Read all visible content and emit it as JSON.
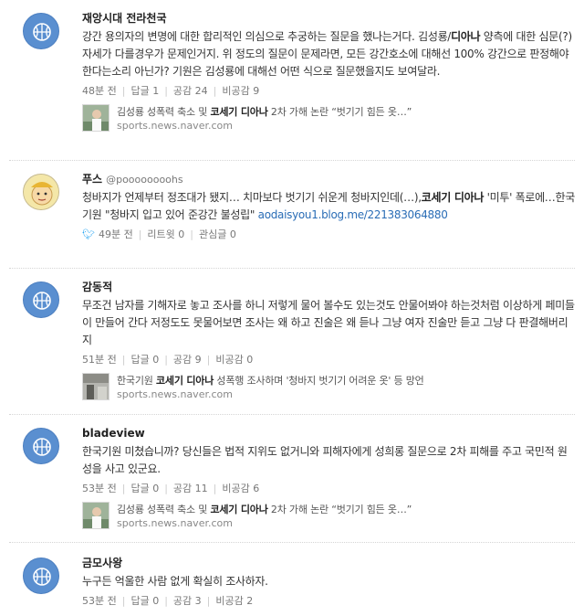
{
  "comments": [
    {
      "author": "재앙시대 전라천국",
      "text_a": "강간 용의자의 변명에 대한 합리적인 의심으로 추궁하는 질문을 했나는거다. 김성룡/",
      "text_bold": "디아나",
      "text_b": " 양측에 대한 심문(?)자세가 다를경우가 문제인거지. 위 정도의 질문이 문제라면, 모든 강간호소에 대해선 100% 강간으로 판정해야 한다는소리 아닌가? 기원은 김성룡에 대해선 어떤 식으로 질문했을지도 보여달라.",
      "time": "48분 전",
      "reply": "답글 1",
      "like": "공감 24",
      "dislike": "비공감 9",
      "news_a": "김성룡 성폭력 축소 및 ",
      "news_bold": "코세기 디아나",
      "news_b": " 2차 가해 논란 “벗기기 힘든 옷…”",
      "news_src": "sports.news.naver.com"
    },
    {
      "author": "푸스",
      "handle": "@poooooooohs",
      "text_a": "청바지가 언제부터 정조대가 됐지… 치마보다 벗기기 쉬운게 청바지인데(…),",
      "text_bold": "코세기 디아나",
      "text_b": " '미투' 폭로에…한국기원 \"청바지 입고 있어 준강간 불성립\" ",
      "text_link": "aodaisyou1.blog.me/221383064880",
      "time": "49분 전",
      "retweet": "리트윗 0",
      "interest": "관심글 0"
    },
    {
      "author": "감동적",
      "text": "무조건 남자를 기해자로 놓고 조사를 하니 저렇게 물어 볼수도 있는것도 안물어봐야 하는것처럼 이상하게 페미들이 만들어 간다 저정도도 못물어보면 조사는 왜 하고 진술은 왜 듣나 그냥 여자 진술만 듣고 그냥 다 판결해버리지",
      "time": "51분 전",
      "reply": "답글 0",
      "like": "공감 9",
      "dislike": "비공감 0",
      "news_a": "한국기원 ",
      "news_bold": "코세기 디아나",
      "news_b": " 성폭행 조사하며 '청바지 벗기기 어려운 옷' 등 망언",
      "news_src": "sports.news.naver.com"
    },
    {
      "author": "bladeview",
      "text": "한국기원 미쳤습니까? 당신들은 법적 지위도 없거니와 피해자에게 성희롱 질문으로 2차 피해를 주고 국민적 원성을 사고 있군요.",
      "time": "53분 전",
      "reply": "답글 0",
      "like": "공감 11",
      "dislike": "비공감 6",
      "news_a": "김성룡 성폭력 축소 및 ",
      "news_bold": "코세기 디아나",
      "news_b": " 2차 가해 논란 “벗기기 힘든 옷…”",
      "news_src": "sports.news.naver.com"
    },
    {
      "author": "금모사왕",
      "text": "누구든 억울한 사람 없게 확실히 조사하자.",
      "time": "53분 전",
      "reply": "답글 0",
      "like": "공감 3",
      "dislike": "비공감 2"
    }
  ],
  "icons": {
    "avatar": "basketball-icon",
    "twitter": "twitter-icon"
  },
  "colors": {
    "avatar_blue": "#5a8fd0",
    "link": "#2a6db6",
    "twitter": "#1da1f2"
  }
}
